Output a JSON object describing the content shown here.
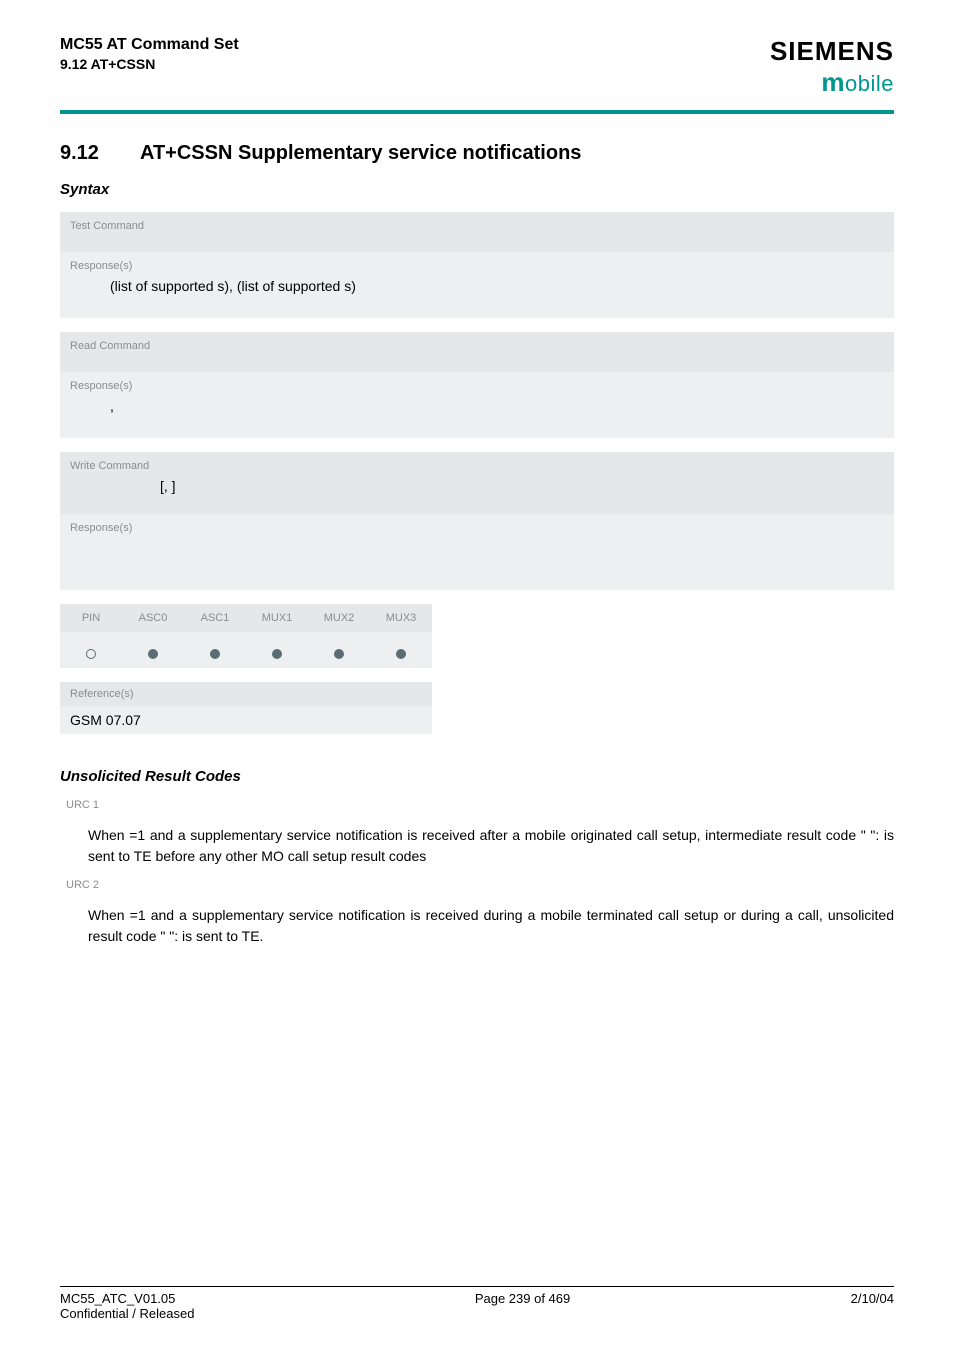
{
  "header": {
    "product": "MC55 AT Command Set",
    "section_ref": "9.12 AT+CSSN",
    "brand": "SIEMENS",
    "subbrand_m": "m",
    "subbrand_rest": "obile"
  },
  "section": {
    "number": "9.12",
    "title": "AT+CSSN   Supplementary service notifications"
  },
  "syntax_label": "Syntax",
  "blocks": {
    "test": {
      "header": "Test Command",
      "resp_label": "Response(s)",
      "resp_text": "(list of supported      s), (list of supported      s)"
    },
    "read": {
      "header": "Read Command",
      "resp_label": "Response(s)",
      "resp_text": ","
    },
    "write": {
      "header": "Write Command",
      "header_extra": "[,      ]",
      "resp_label": "Response(s)"
    }
  },
  "matrix": {
    "cols": [
      "PIN",
      "ASC0",
      "ASC1",
      "MUX1",
      "MUX2",
      "MUX3"
    ],
    "vals": [
      "empty",
      "filled",
      "filled",
      "filled",
      "filled",
      "filled"
    ]
  },
  "reference": {
    "label": "Reference(s)",
    "value": "GSM 07.07"
  },
  "urc_heading": "Unsolicited Result Codes",
  "urc1": {
    "label": "URC 1",
    "text": "When       =1 and a supplementary service notification is received after a mobile originated call setup, intermediate result code \"           \":                    is sent to TE before any other MO call setup result codes"
  },
  "urc2": {
    "label": "URC 2",
    "text": "When       =1 and a supplementary service notification is received during a mobile terminated call setup or during a call, unsolicited result code \"           \":                    is sent to TE."
  },
  "footer": {
    "left1": "MC55_ATC_V01.05",
    "left2": "Confidential / Released",
    "center": "Page 239 of 469",
    "right": "2/10/04"
  }
}
